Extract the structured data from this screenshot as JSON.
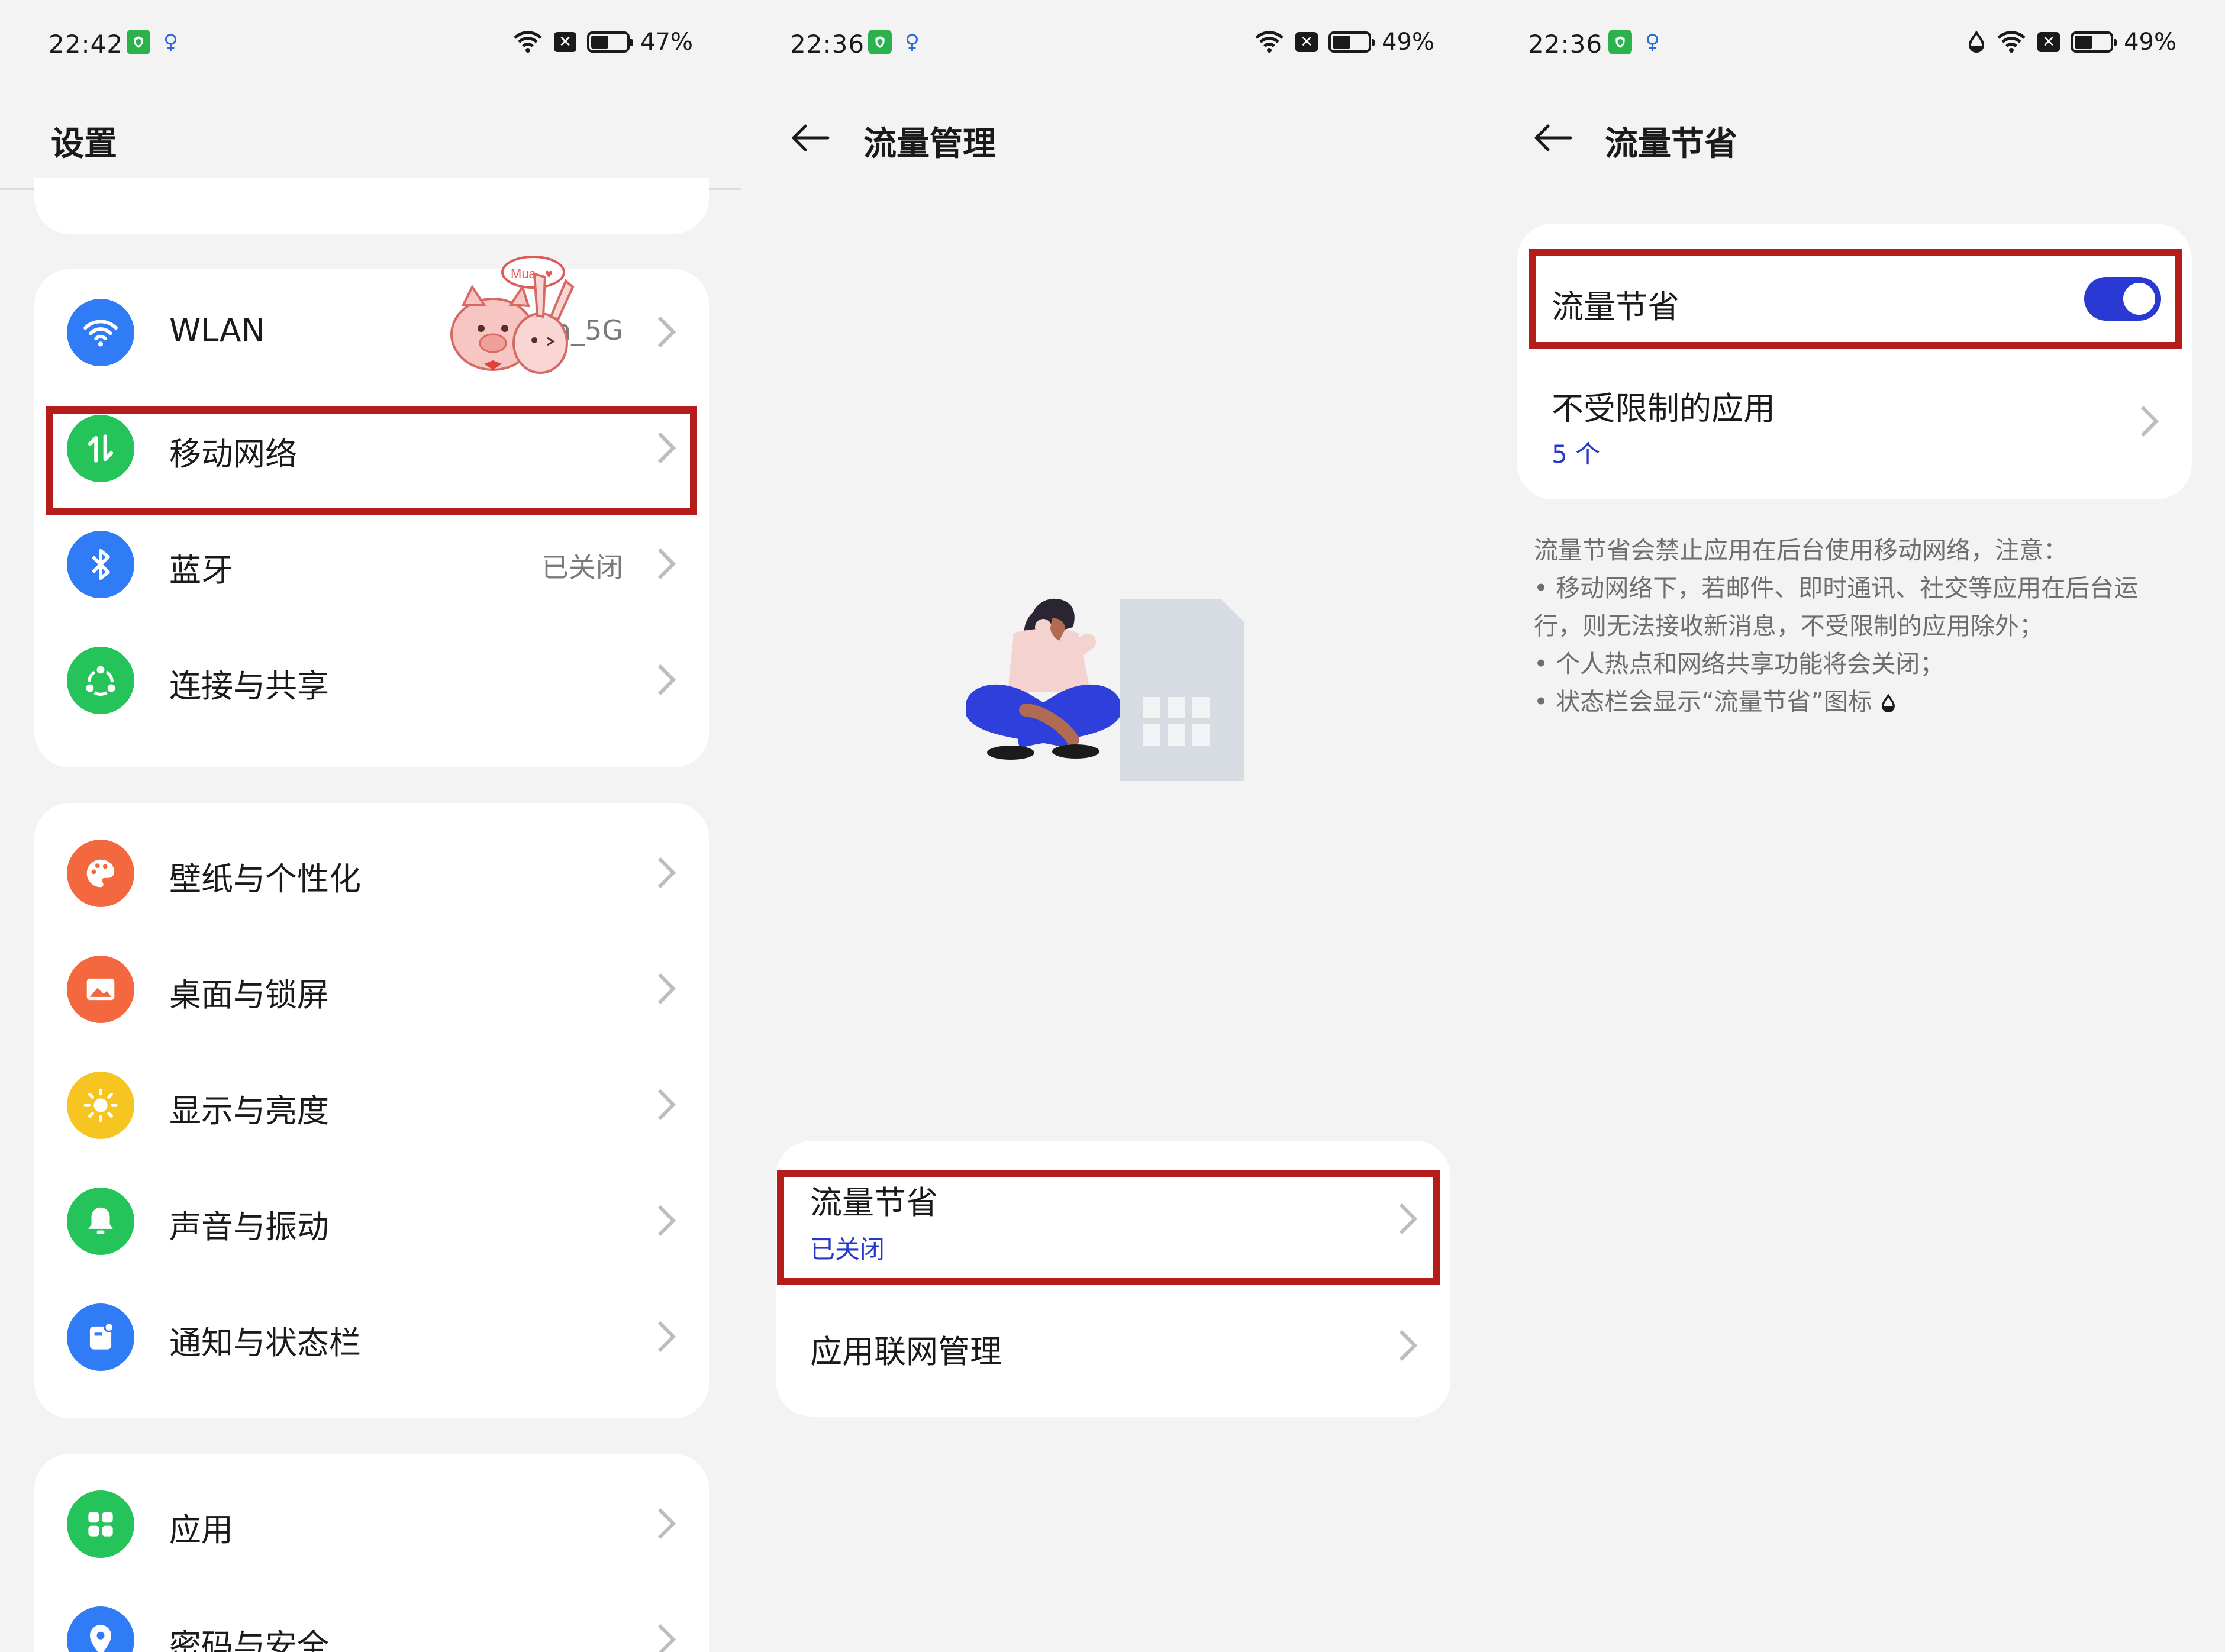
{
  "colors": {
    "background": "#f3f3f3",
    "card": "#ffffff",
    "highlight_border": "#b31d1a",
    "accent_blue": "#2b39d4",
    "link_blue": "#2638c9"
  },
  "panel1": {
    "status": {
      "time": "22:42",
      "battery": "47%",
      "battery_fraction": 0.47
    },
    "title": "设置",
    "items_group1": [
      {
        "label": "WLAN",
        "value": "yn_5G",
        "icon": "wifi-icon",
        "color": "#2f7cf6"
      },
      {
        "label": "移动网络",
        "value": "",
        "icon": "mobile-data-icon",
        "color": "#24c45a"
      },
      {
        "label": "蓝牙",
        "value": "已关闭",
        "icon": "bluetooth-icon",
        "color": "#2f7cf6"
      },
      {
        "label": "连接与共享",
        "value": "",
        "icon": "share-icon",
        "color": "#24c45a"
      }
    ],
    "items_group2": [
      {
        "label": "壁纸与个性化",
        "icon": "palette-icon",
        "color": "#f4683f"
      },
      {
        "label": "桌面与锁屏",
        "icon": "image-icon",
        "color": "#f4683f"
      },
      {
        "label": "显示与亮度",
        "icon": "sun-icon",
        "color": "#f7c521"
      },
      {
        "label": "声音与振动",
        "icon": "bell-icon",
        "color": "#24c45a"
      },
      {
        "label": "通知与状态栏",
        "icon": "notification-icon",
        "color": "#2f7cf6"
      }
    ],
    "items_group3": [
      {
        "label": "应用",
        "icon": "apps-grid-icon",
        "color": "#24c45a"
      },
      {
        "label": "密码与安全",
        "icon": "location-pin-icon",
        "color": "#2f7cf6"
      }
    ],
    "sticker_text": "Mua"
  },
  "panel2": {
    "status": {
      "time": "22:36",
      "battery": "49%",
      "battery_fraction": 0.49
    },
    "title": "流量管理",
    "items": [
      {
        "label": "流量节省",
        "sub": "已关闭"
      },
      {
        "label": "应用联网管理"
      }
    ]
  },
  "panel3": {
    "status": {
      "time": "22:36",
      "battery": "49%",
      "battery_fraction": 0.49
    },
    "title": "流量节省",
    "toggle_label": "流量节省",
    "toggle_on": true,
    "unrestricted_label": "不受限制的应用",
    "unrestricted_count": "5 个",
    "note_lines": [
      "流量节省会禁止应用在后台使用移动网络，注意：",
      "• 移动网络下，若邮件、即时通讯、社交等应用在后台运",
      "行，则无法接收新消息，不受限制的应用除外；",
      "• 个人热点和网络共享功能将会关闭；",
      "• 状态栏会显示“流量节省”图标"
    ]
  }
}
